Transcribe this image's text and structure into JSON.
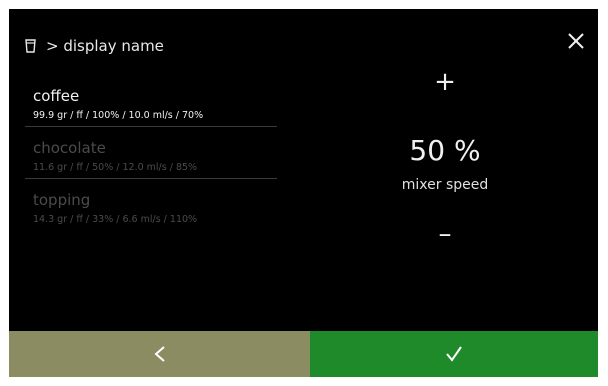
{
  "header": {
    "title": "> display name",
    "icon": "cup-icon"
  },
  "ingredients": [
    {
      "name": "coffee",
      "params": "99.9 gr / ff / 100% / 10.0 ml/s / 70%",
      "active": true
    },
    {
      "name": "chocolate",
      "params": "11.6 gr / ff / 50% / 12.0 ml/s / 85%",
      "active": false
    },
    {
      "name": "topping",
      "params": "14.3 gr / ff / 33% / 6.6 ml/s / 110%",
      "active": false
    }
  ],
  "control": {
    "plus": "+",
    "value": "50 %",
    "label": "mixer speed",
    "minus": "–"
  },
  "footer": {
    "back_icon": "chevron-left-icon",
    "confirm_icon": "check-icon"
  },
  "colors": {
    "screen_bg": "#000000",
    "back_button": "#8c8c62",
    "confirm_button": "#1e8a2a",
    "inactive_text": "#4b4b4b"
  }
}
